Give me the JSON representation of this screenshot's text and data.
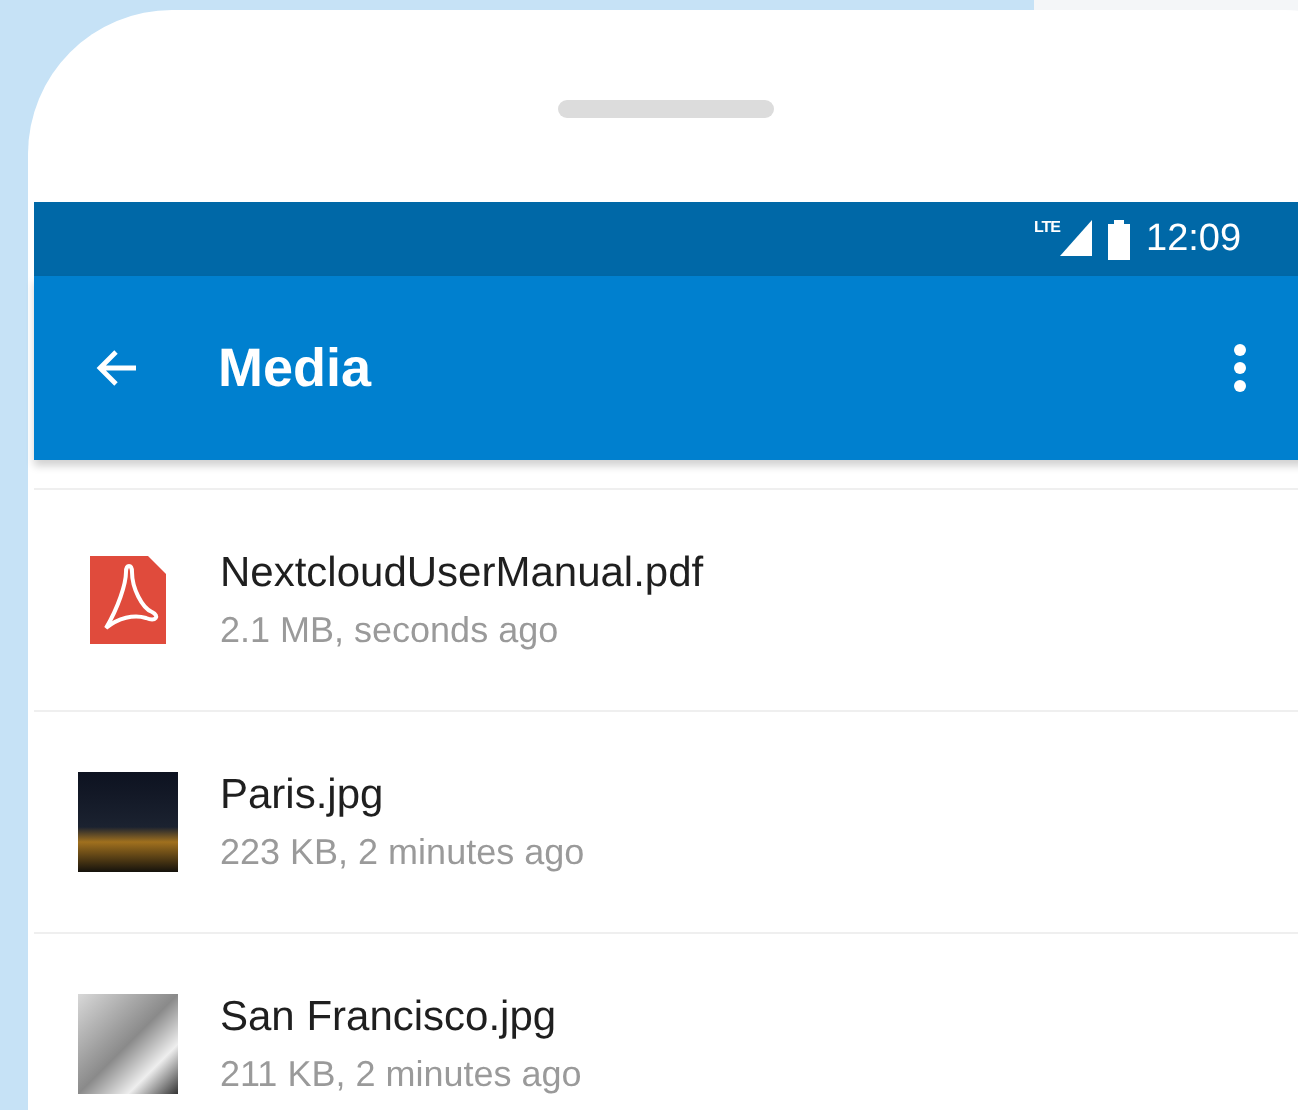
{
  "status_bar": {
    "network": "LTE",
    "time": "12:09"
  },
  "app_bar": {
    "title": "Media"
  },
  "files": [
    {
      "kind": "pdf",
      "name": "NextcloudUserManual.pdf",
      "details": "2.1 MB, seconds ago"
    },
    {
      "kind": "night-photo",
      "name": "Paris.jpg",
      "details": "223 KB, 2 minutes ago"
    },
    {
      "kind": "grey-photo",
      "name": "San Francisco.jpg",
      "details": "211 KB, 2 minutes ago"
    }
  ]
}
